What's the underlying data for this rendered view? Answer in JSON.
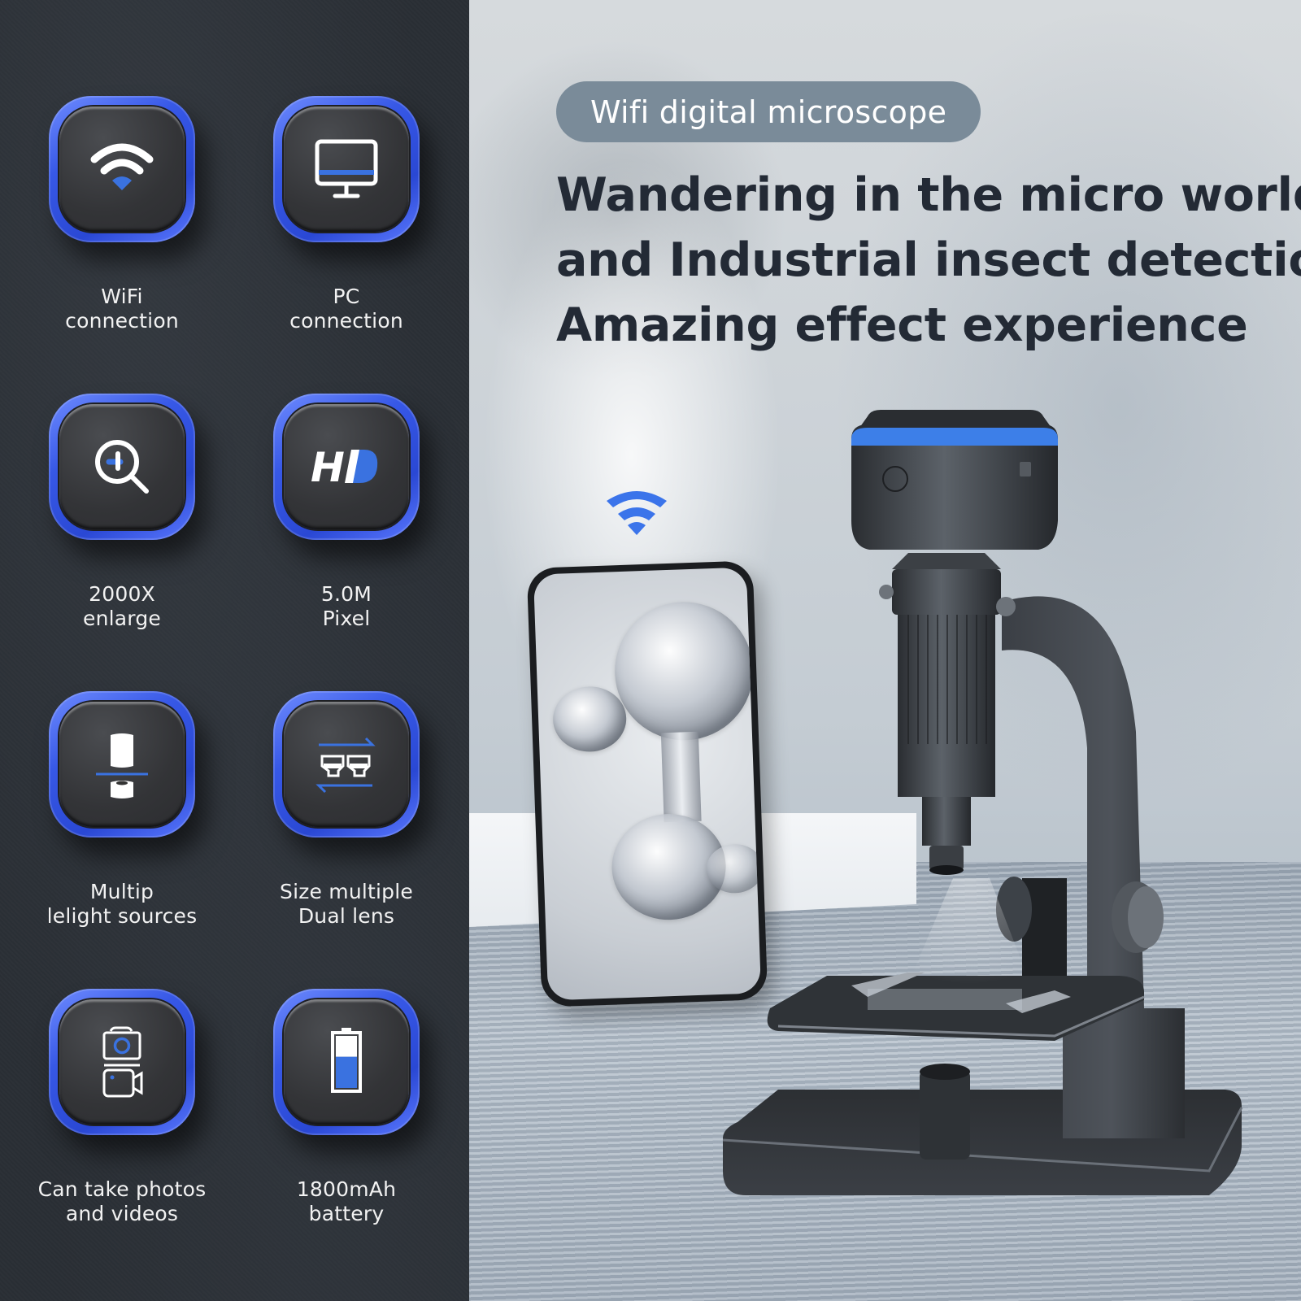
{
  "features": [
    {
      "id": "wifi",
      "icon": "wifi-icon",
      "lines": [
        "WiFi",
        "connection"
      ]
    },
    {
      "id": "pc",
      "icon": "monitor-icon",
      "lines": [
        "PC",
        "connection"
      ]
    },
    {
      "id": "zoom",
      "icon": "magnifier-plus-icon",
      "lines": [
        "2000X",
        "enlarge"
      ]
    },
    {
      "id": "hd",
      "icon": "hd-icon",
      "icon_text": "HD",
      "lines": [
        "5.0M",
        "Pixel"
      ]
    },
    {
      "id": "light",
      "icon": "light-source-icon",
      "lines": [
        "Multip",
        "lelight sources"
      ]
    },
    {
      "id": "lens",
      "icon": "dual-lens-icon",
      "lines": [
        "Size multiple",
        "Dual lens"
      ]
    },
    {
      "id": "camera",
      "icon": "photo-video-icon",
      "lines": [
        "Can take photos",
        "and videos"
      ]
    },
    {
      "id": "battery",
      "icon": "battery-icon",
      "battery_level": 0.6,
      "lines": [
        "1800mAh",
        "battery"
      ]
    }
  ],
  "hero": {
    "badge": "Wifi digital microscope",
    "headline": [
      "Wandering in the micro world",
      "and Industrial insect detection",
      "Amazing effect experience"
    ]
  },
  "colors": {
    "accent_blue": "#3a5ee8",
    "icon_blue": "#3a72e0",
    "badge_bg": "#7a8b99",
    "headline": "#232a35",
    "panel_bg": "#2a2f35"
  }
}
